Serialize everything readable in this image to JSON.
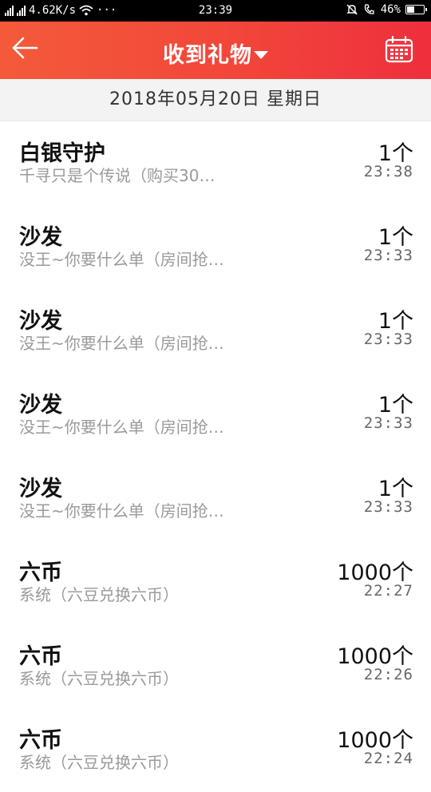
{
  "status_bar": {
    "network_speed": "4.62K/s",
    "more": "···",
    "time": "23:39",
    "battery": "46%"
  },
  "header": {
    "back_icon": "arrow-left-icon",
    "title": "收到礼物",
    "calendar_icon": "calendar-icon",
    "background_color": "#f2463a"
  },
  "date_bar": {
    "text": "2018年05月20日 星期日"
  },
  "gifts": [
    {
      "name": "白银守护",
      "source": "千寻只是个传说（购买30…",
      "quantity": "1个",
      "time": "23:38"
    },
    {
      "name": "沙发",
      "source": "没王~你要什么单（房间抢…",
      "quantity": "1个",
      "time": "23:33"
    },
    {
      "name": "沙发",
      "source": "没王~你要什么单（房间抢…",
      "quantity": "1个",
      "time": "23:33"
    },
    {
      "name": "沙发",
      "source": "没王~你要什么单（房间抢…",
      "quantity": "1个",
      "time": "23:33"
    },
    {
      "name": "沙发",
      "source": "没王~你要什么单（房间抢…",
      "quantity": "1个",
      "time": "23:33"
    },
    {
      "name": "六币",
      "source": "系统（六豆兑换六币）",
      "quantity": "1000个",
      "time": "22:27"
    },
    {
      "name": "六币",
      "source": "系统（六豆兑换六币）",
      "quantity": "1000个",
      "time": "22:26"
    },
    {
      "name": "六币",
      "source": "系统（六豆兑换六币）",
      "quantity": "1000个",
      "time": "22:24"
    }
  ]
}
